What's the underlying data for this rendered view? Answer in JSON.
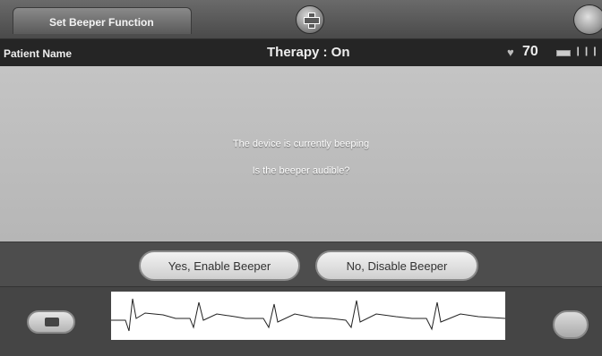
{
  "header": {
    "title": "Set Beeper Function"
  },
  "status": {
    "patient_label": "Patient Name",
    "therapy": "Therapy : On",
    "heart_rate": "70"
  },
  "dialog": {
    "message": "The device is currently beeping",
    "question": "Is the beeper audible?"
  },
  "actions": {
    "yes_label": "Yes, Enable Beeper",
    "no_label": "No, Disable Beeper"
  },
  "icons": {
    "add": "plus-icon",
    "globe": "globe-icon",
    "heart": "heart-icon",
    "battery": "battery-icon",
    "signal": "signal-icon",
    "camera": "camera-icon",
    "ecg": "ecg-icon"
  }
}
